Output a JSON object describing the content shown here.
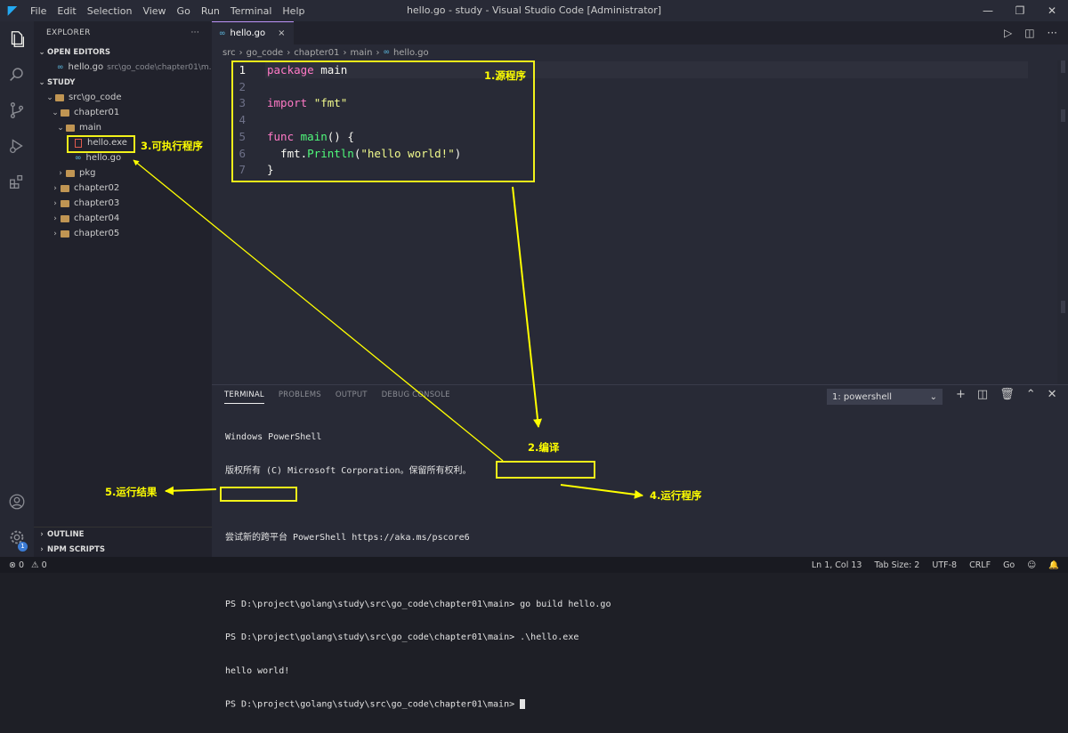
{
  "window": {
    "title": "hello.go - study - Visual Studio Code [Administrator]",
    "menu": [
      "File",
      "Edit",
      "Selection",
      "View",
      "Go",
      "Run",
      "Terminal",
      "Help"
    ]
  },
  "sidebar": {
    "title": "EXPLORER",
    "more": "···",
    "open_editors_label": "OPEN EDITORS",
    "open_editor": {
      "name": "hello.go",
      "path": "src\\go_code\\chapter01\\m..."
    },
    "workspace_label": "STUDY",
    "tree": [
      {
        "label": "src\\go_code",
        "type": "folder",
        "open": true
      },
      {
        "label": "chapter01",
        "type": "folder",
        "open": true
      },
      {
        "label": "main",
        "type": "folder",
        "open": true
      },
      {
        "label": "hello.exe",
        "type": "exe"
      },
      {
        "label": "hello.go",
        "type": "go"
      },
      {
        "label": "pkg",
        "type": "folder",
        "open": false
      },
      {
        "label": "chapter02",
        "type": "folder",
        "open": false
      },
      {
        "label": "chapter03",
        "type": "folder",
        "open": false
      },
      {
        "label": "chapter04",
        "type": "folder",
        "open": false
      },
      {
        "label": "chapter05",
        "type": "folder",
        "open": false
      }
    ],
    "outline_label": "OUTLINE",
    "npm_label": "NPM SCRIPTS",
    "settings_badge": "1"
  },
  "editor": {
    "tab": {
      "name": "hello.go",
      "close": "×"
    },
    "breadcrumb": [
      "src",
      "go_code",
      "chapter01",
      "main",
      "hello.go"
    ],
    "lines": [
      {
        "n": "1",
        "tokens": [
          {
            "t": "package",
            "c": "k"
          },
          {
            "t": " main",
            "c": "p"
          }
        ]
      },
      {
        "n": "2",
        "tokens": []
      },
      {
        "n": "3",
        "tokens": [
          {
            "t": "import",
            "c": "k"
          },
          {
            "t": " ",
            "c": "p"
          },
          {
            "t": "\"fmt\"",
            "c": "s"
          }
        ]
      },
      {
        "n": "4",
        "tokens": []
      },
      {
        "n": "5",
        "tokens": [
          {
            "t": "func",
            "c": "k"
          },
          {
            "t": " ",
            "c": "p"
          },
          {
            "t": "main",
            "c": "f"
          },
          {
            "t": "() {",
            "c": "p"
          }
        ]
      },
      {
        "n": "6",
        "tokens": [
          {
            "t": "  fmt.",
            "c": "p"
          },
          {
            "t": "Println",
            "c": "f"
          },
          {
            "t": "(",
            "c": "p"
          },
          {
            "t": "\"hello world!\"",
            "c": "s"
          },
          {
            "t": ")",
            "c": "p"
          }
        ]
      },
      {
        "n": "7",
        "tokens": [
          {
            "t": "}",
            "c": "p"
          }
        ]
      }
    ]
  },
  "panel": {
    "tabs": [
      "TERMINAL",
      "PROBLEMS",
      "OUTPUT",
      "DEBUG CONSOLE"
    ],
    "terminal_select": "1: powershell",
    "lines": [
      "Windows PowerShell",
      "版权所有 (C) Microsoft Corporation。保留所有权利。",
      "",
      "尝试新的跨平台 PowerShell https://aka.ms/pscore6",
      "",
      "PS D:\\project\\golang\\study\\src\\go_code\\chapter01\\main> go build hello.go",
      "PS D:\\project\\golang\\study\\src\\go_code\\chapter01\\main> .\\hello.exe",
      "hello world!",
      "PS D:\\project\\golang\\study\\src\\go_code\\chapter01\\main> "
    ]
  },
  "statusbar": {
    "errors": "⊗ 0",
    "warnings": "⚠ 0",
    "position": "Ln 1, Col 13",
    "tab_size": "Tab Size: 2",
    "encoding": "UTF-8",
    "eol": "CRLF",
    "language": "Go"
  },
  "annotations": {
    "source": "1.源程序",
    "compile": "2.编译",
    "executable": "3.可执行程序",
    "run": "4.运行程序",
    "result": "5.运行结果",
    "color": "#ffff00"
  }
}
